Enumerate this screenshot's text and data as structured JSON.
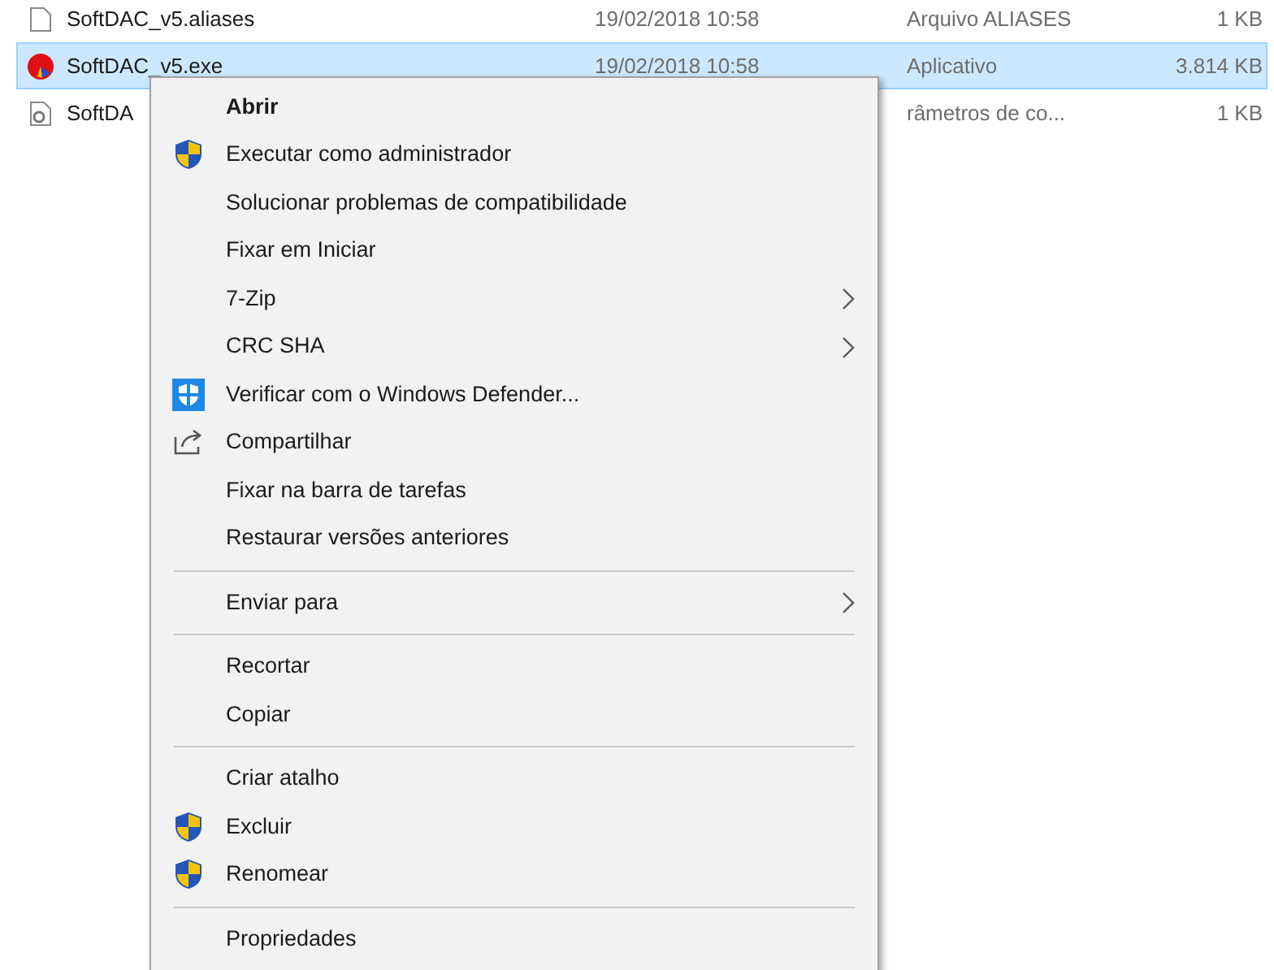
{
  "files": [
    {
      "name": "SoftDAC_v5.aliases",
      "date": "19/02/2018 10:58",
      "type": "Arquivo ALIASES",
      "size": "1 KB",
      "selected": false
    },
    {
      "name": "SoftDAC_v5.exe",
      "date": "19/02/2018 10:58",
      "type": "Aplicativo",
      "size": "3.814 KB",
      "selected": true
    },
    {
      "name": "SoftDA",
      "type": "râmetros de co...",
      "size": "1 KB",
      "selected": false
    }
  ],
  "context_menu": [
    {
      "kind": "plain",
      "label": "Abrir",
      "default": true,
      "submenu": false
    },
    {
      "kind": "shield",
      "label": "Executar como administrador",
      "default": false,
      "submenu": false
    },
    {
      "kind": "plain",
      "label": "Solucionar problemas de compatibilidade",
      "default": false,
      "submenu": false
    },
    {
      "kind": "plain",
      "label": "Fixar em Iniciar",
      "default": false,
      "submenu": false
    },
    {
      "kind": "plain",
      "label": "7-Zip",
      "default": false,
      "submenu": true
    },
    {
      "kind": "plain",
      "label": "CRC SHA",
      "default": false,
      "submenu": true
    },
    {
      "kind": "defender",
      "label": "Verificar com o Windows Defender...",
      "default": false,
      "submenu": false
    },
    {
      "kind": "share",
      "label": "Compartilhar",
      "default": false,
      "submenu": false
    },
    {
      "kind": "plain",
      "label": "Fixar na barra de tarefas",
      "default": false,
      "submenu": false
    },
    {
      "kind": "plain",
      "label": "Restaurar versões anteriores",
      "default": false,
      "submenu": false
    },
    {
      "kind": "separator"
    },
    {
      "kind": "plain",
      "label": "Enviar para",
      "default": false,
      "submenu": true
    },
    {
      "kind": "separator"
    },
    {
      "kind": "plain",
      "label": "Recortar",
      "default": false,
      "submenu": false
    },
    {
      "kind": "plain",
      "label": "Copiar",
      "default": false,
      "submenu": false
    },
    {
      "kind": "separator"
    },
    {
      "kind": "plain",
      "label": "Criar atalho",
      "default": false,
      "submenu": false
    },
    {
      "kind": "shield",
      "label": "Excluir",
      "default": false,
      "submenu": false
    },
    {
      "kind": "shield",
      "label": "Renomear",
      "default": false,
      "submenu": false
    },
    {
      "kind": "separator"
    },
    {
      "kind": "plain",
      "label": "Propriedades",
      "default": false,
      "submenu": false
    }
  ]
}
